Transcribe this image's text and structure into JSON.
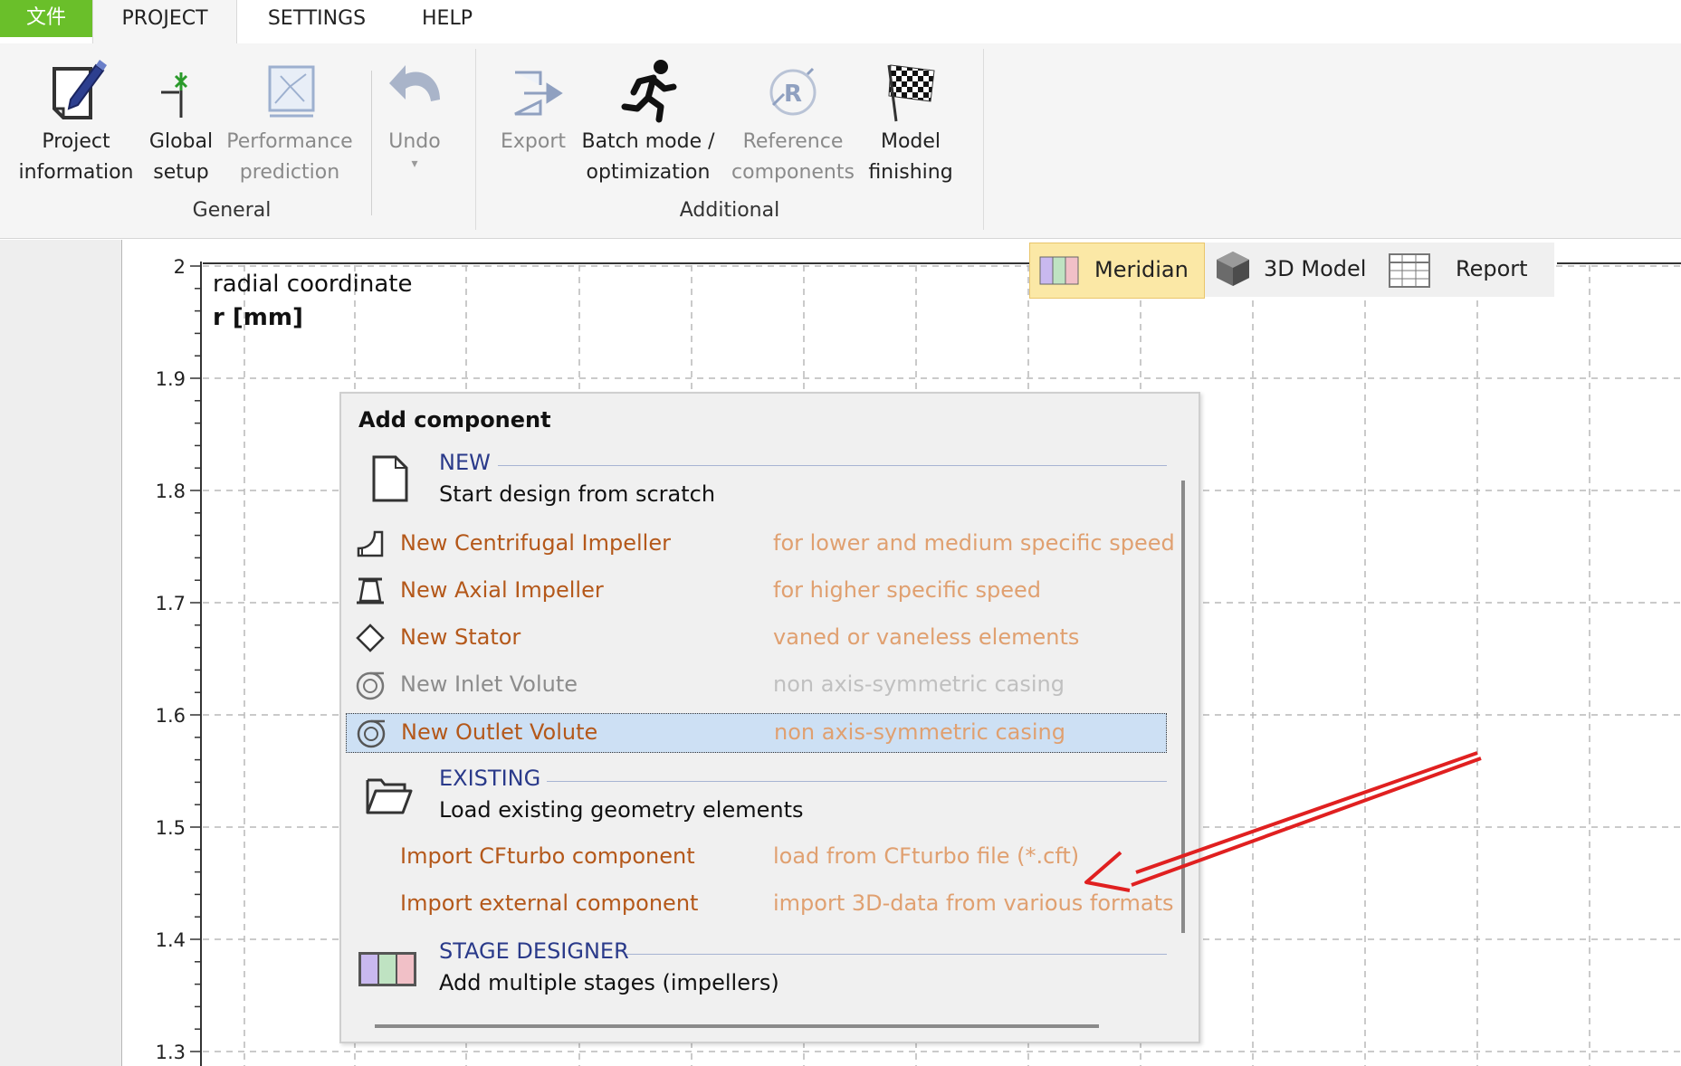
{
  "menu": {
    "file": "文件",
    "tabs": [
      "PROJECT",
      "SETTINGS",
      "HELP"
    ]
  },
  "ribbon": {
    "general": {
      "label": "General",
      "buttons": {
        "project_info": "Project\ninformation",
        "global_setup": "Global\nsetup",
        "performance": "Performance\nprediction",
        "undo": "Undo"
      }
    },
    "additional": {
      "label": "Additional",
      "buttons": {
        "export": "Export",
        "batch": "Batch mode /\noptimization",
        "reference": "Reference\ncomponents",
        "finishing": "Model\nfinishing"
      }
    }
  },
  "views": {
    "meridian": "Meridian",
    "model3d": "3D Model",
    "report": "Report"
  },
  "axis": {
    "title": "radial coordinate",
    "unit": "r [mm]",
    "ticks": [
      "2",
      "1.9",
      "1.8",
      "1.7",
      "1.6",
      "1.5",
      "1.4",
      "1.3"
    ]
  },
  "dropdown": {
    "title": "Add component",
    "new_section": {
      "head": "NEW",
      "sub": "Start design from scratch"
    },
    "new_items": [
      {
        "name": "New Centrifugal Impeller",
        "desc": "for lower and medium specific speed",
        "icon": "centrifugal-impeller-icon"
      },
      {
        "name": "New Axial Impeller",
        "desc": "for higher specific speed",
        "icon": "axial-impeller-icon"
      },
      {
        "name": "New Stator",
        "desc": "vaned or vaneless elements",
        "icon": "stator-icon"
      },
      {
        "name": "New Inlet Volute",
        "desc": "non axis-symmetric casing",
        "icon": "volute-icon"
      },
      {
        "name": "New Outlet Volute",
        "desc": "non axis-symmetric casing",
        "icon": "volute-icon"
      }
    ],
    "existing_section": {
      "head": "EXISTING",
      "sub": "Load existing geometry elements"
    },
    "existing_items": [
      {
        "name": "Import CFturbo component",
        "desc": "load from CFturbo file (*.cft)"
      },
      {
        "name": "Import external component",
        "desc": "import 3D-data from various formats"
      }
    ],
    "stage_section": {
      "head": "STAGE DESIGNER",
      "sub": "Add multiple stages (impellers)"
    }
  },
  "colors": {
    "file_tab": "#6abf2a",
    "item_name": "#b4581a",
    "item_desc": "#e0a070",
    "section_head": "#2a3a8a",
    "selection": "#cde0f4",
    "annotation_arrow": "#e02020"
  }
}
